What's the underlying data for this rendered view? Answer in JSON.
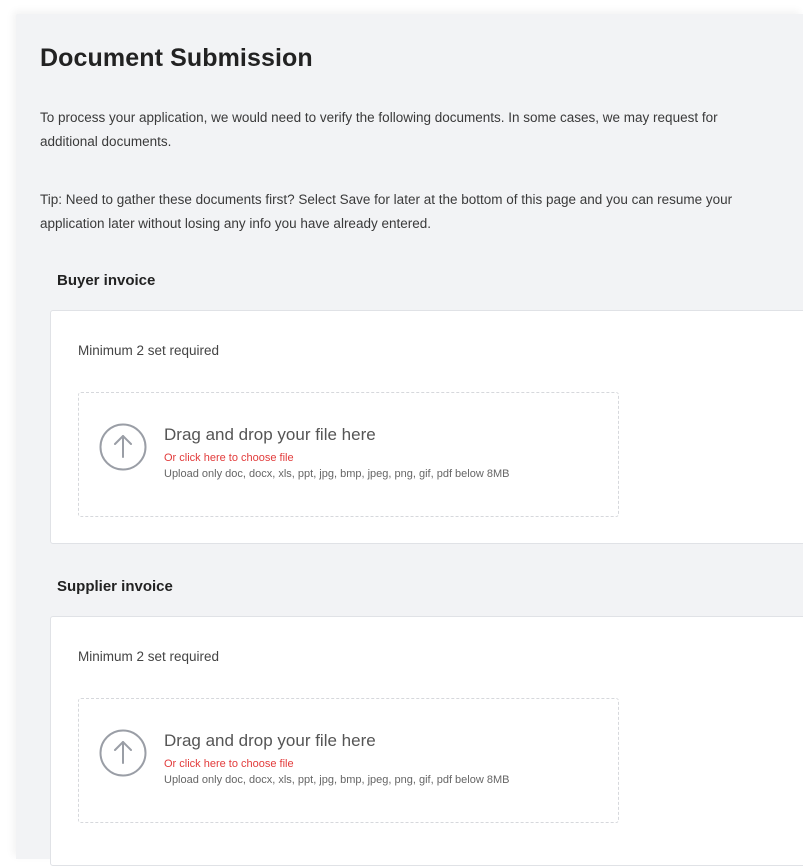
{
  "page": {
    "title": "Document Submission",
    "intro": "To process your application, we would need to verify the following documents. In some cases, we may request for additional documents.",
    "tip": "Tip: Need to gather these documents first? Select Save for later at the bottom of this page and you can resume your application later without losing any info you have already entered."
  },
  "sections": [
    {
      "title": "Buyer invoice",
      "requirement": "Minimum 2 set required",
      "upload": {
        "title": "Drag and drop your file here",
        "link": "Or click here to choose file",
        "hint": "Upload only doc, docx, xls, ppt, jpg, bmp, jpeg, png, gif, pdf below 8MB",
        "icon": "upload-arrow-icon"
      }
    },
    {
      "title": "Supplier invoice",
      "requirement": "Minimum 2 set required",
      "upload": {
        "title": "Drag and drop your file here",
        "link": "Or click here to choose file",
        "hint": "Upload only doc, docx, xls, ppt, jpg, bmp, jpeg, png, gif, pdf below 8MB",
        "icon": "upload-arrow-icon"
      }
    }
  ],
  "colors": {
    "panel_background": "#f2f3f5",
    "link": "#e23b3b",
    "icon": "#9a9ea6"
  }
}
